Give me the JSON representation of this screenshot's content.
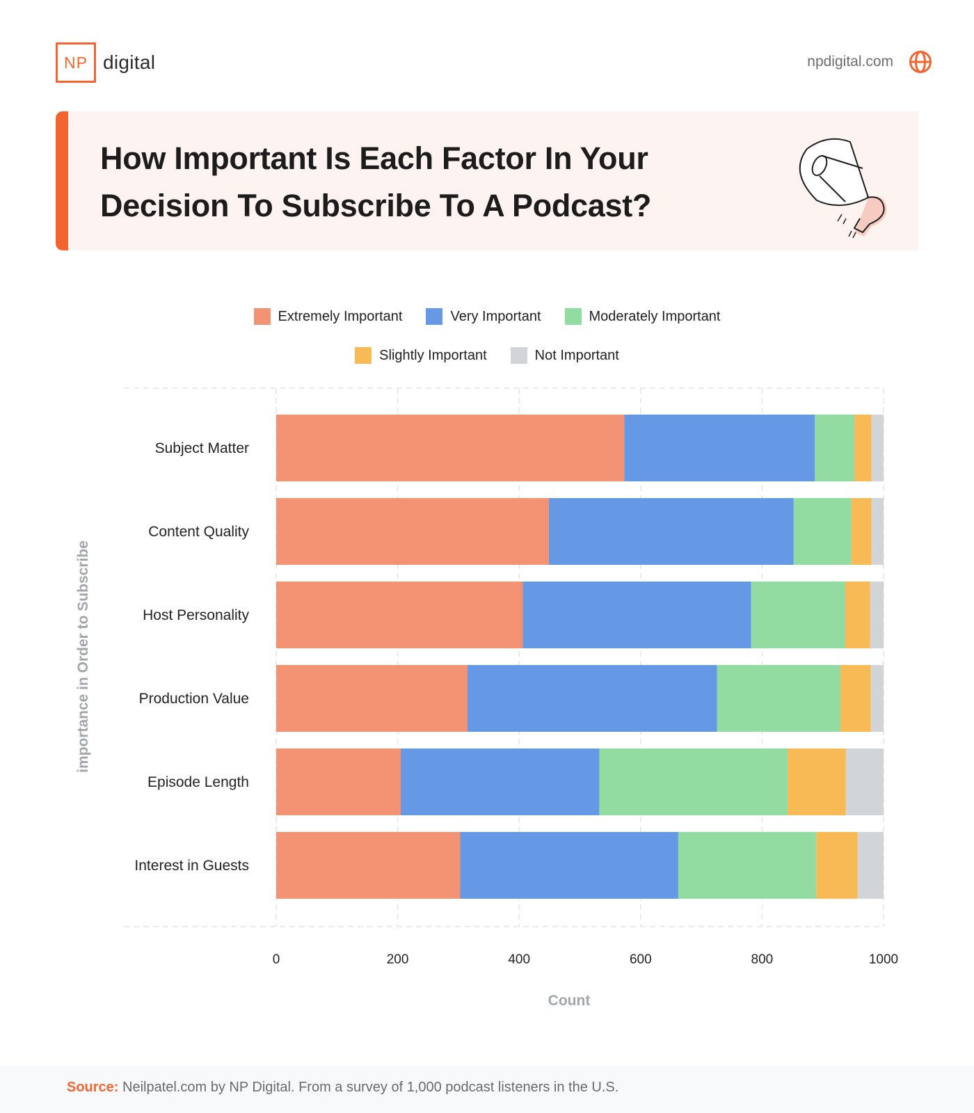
{
  "brand": {
    "logo_mark": "NP",
    "logo_word": "digital",
    "site_url": "npdigital.com",
    "globe_icon": "globe-icon",
    "accent_color": "#f26430"
  },
  "banner": {
    "title_line1": "How Important Is Each Factor In Your",
    "title_line2": "Decision To Subscribe To A Podcast?",
    "illustration": "megaphone-icon"
  },
  "chart_data": {
    "type": "bar",
    "orientation": "horizontal",
    "stacked": true,
    "title": "How Important Is Each Factor In Your Decision To Subscribe To A Podcast?",
    "xlabel": "Count",
    "ylabel": "importance in Order to Subscribe",
    "xlim": [
      0,
      1000
    ],
    "xticks": [
      0,
      200,
      400,
      600,
      800,
      1000
    ],
    "grid": true,
    "legend_position": "top-center",
    "categories": [
      "Subject Matter",
      "Content Quality",
      "Host Personality",
      "Production Value",
      "Episode Length",
      "Interest in Guests"
    ],
    "series": [
      {
        "name": "Extremely Important",
        "color": "#f39374",
        "values": [
          573,
          449,
          406,
          315,
          205,
          303
        ]
      },
      {
        "name": "Very Important",
        "color": "#6599e6",
        "values": [
          314,
          403,
          376,
          411,
          327,
          359
        ]
      },
      {
        "name": "Moderately Important",
        "color": "#92dca2",
        "values": [
          65,
          95,
          155,
          203,
          310,
          227
        ]
      },
      {
        "name": "Slightly Important",
        "color": "#f8ba55",
        "values": [
          28,
          33,
          41,
          50,
          96,
          68
        ]
      },
      {
        "name": "Not Important",
        "color": "#d2d5d8",
        "values": [
          20,
          20,
          22,
          21,
          62,
          43
        ]
      }
    ]
  },
  "footer": {
    "source_label": "Source:",
    "source_text": " Neilpatel.com by NP Digital. From a survey of 1,000 podcast listeners in the U.S."
  }
}
